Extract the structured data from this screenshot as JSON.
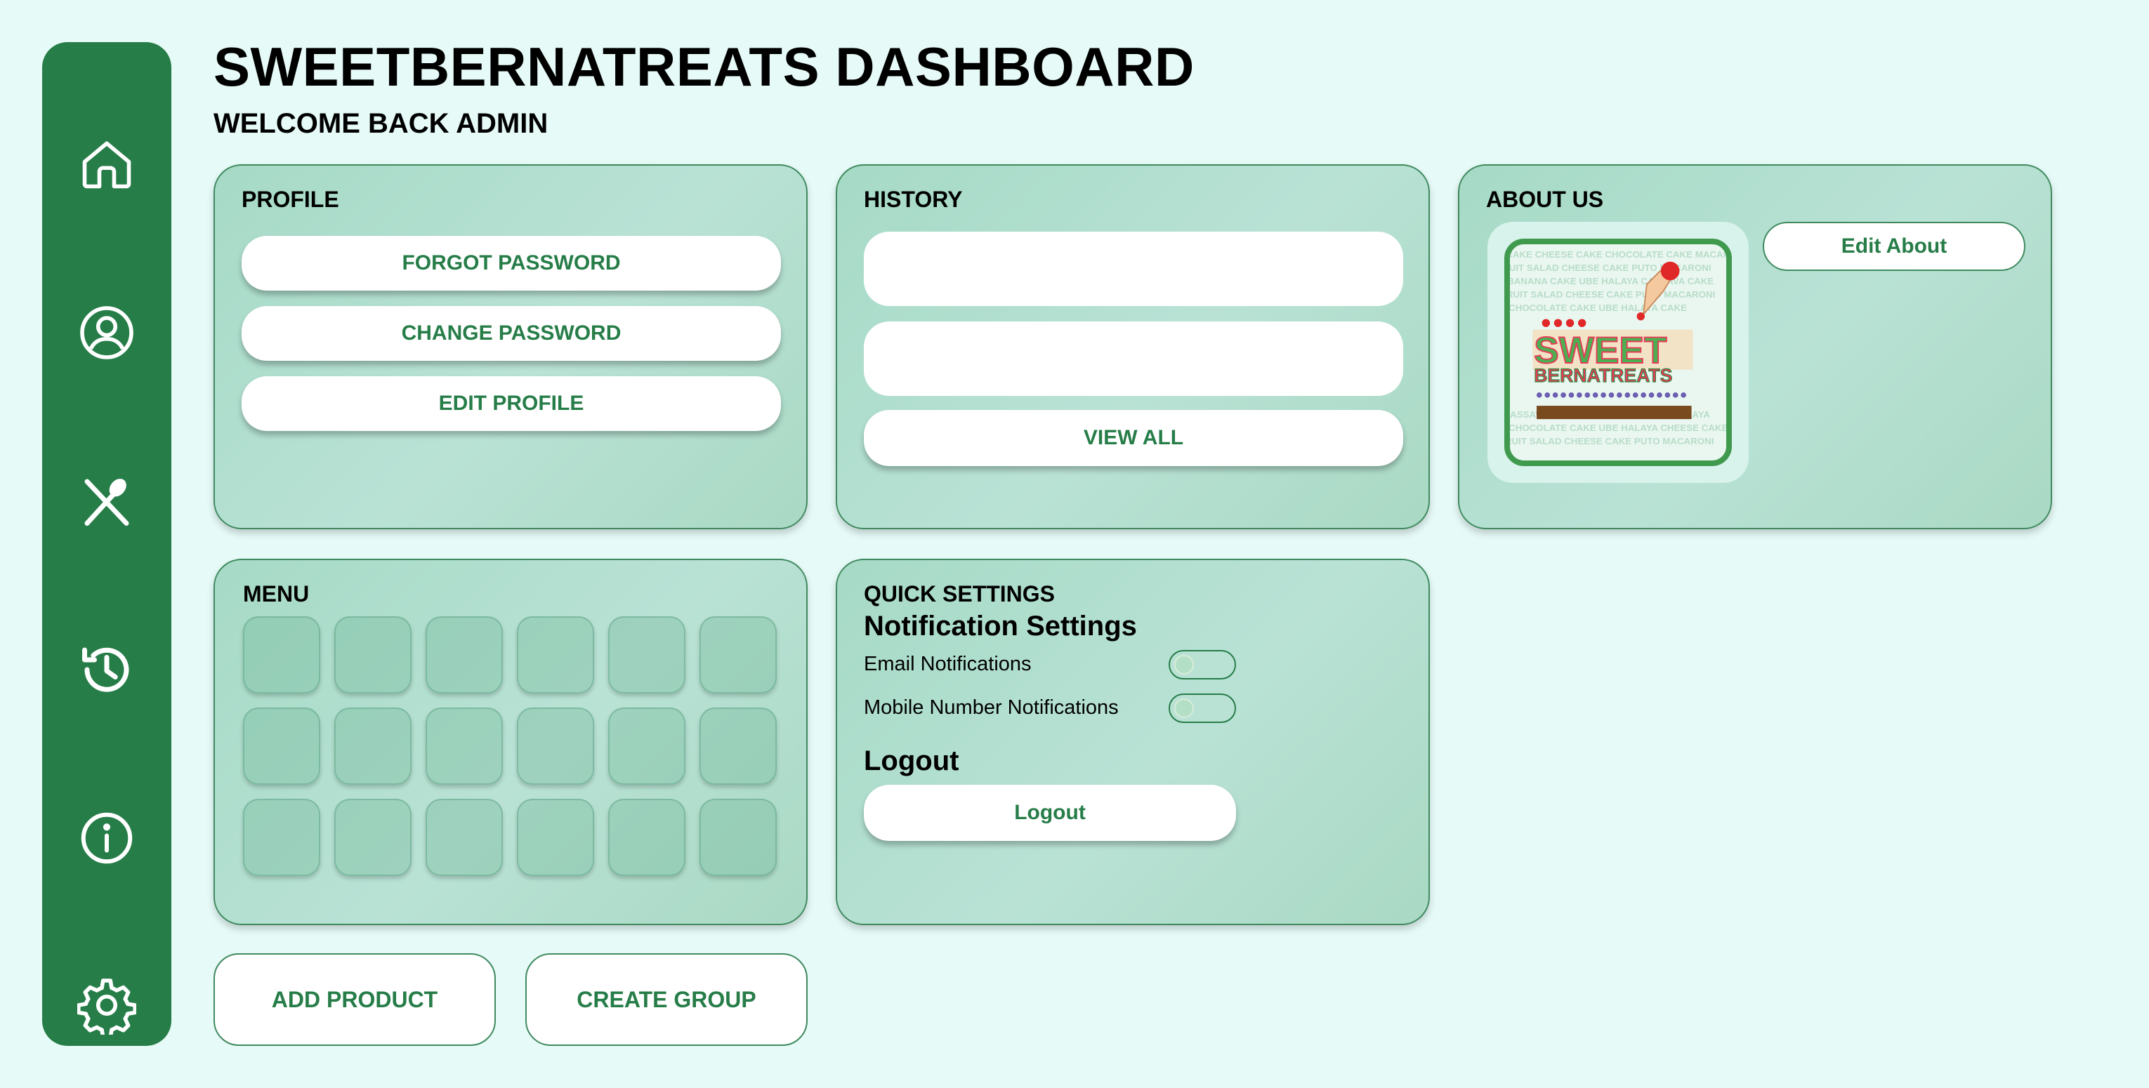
{
  "header": {
    "title": "SWEETBERNATREATS DASHBOARD",
    "subtitle": "WELCOME BACK ADMIN"
  },
  "sidebar": {
    "items": [
      {
        "icon": "home-icon"
      },
      {
        "icon": "user-icon"
      },
      {
        "icon": "utensils-icon"
      },
      {
        "icon": "history-icon"
      },
      {
        "icon": "info-icon"
      },
      {
        "icon": "gear-icon"
      }
    ]
  },
  "profile": {
    "title": "PROFILE",
    "forgot_password": "FORGOT PASSWORD",
    "change_password": "CHANGE PASSWORD",
    "edit_profile": "EDIT PROFILE"
  },
  "history": {
    "title": "HISTORY",
    "view_all": "VIEW ALL"
  },
  "about": {
    "title": "ABOUT US",
    "edit_about": "Edit About",
    "logo_text_top": "SWEET",
    "logo_text_bottom": "BERNATREATS"
  },
  "menu": {
    "title": "MENU"
  },
  "quick_settings": {
    "title": "QUICK SETTINGS",
    "notification_heading": "Notification Settings",
    "email_label": "Email Notifications",
    "mobile_label": "Mobile Number Notifications",
    "logout_heading": "Logout",
    "logout_button": "Logout"
  },
  "actions": {
    "add_product": "ADD PRODUCT",
    "create_group": "CREATE GROUP"
  },
  "colors": {
    "brand_green": "#267d48",
    "background": "#e6faf7",
    "card": "#a6dac6"
  }
}
